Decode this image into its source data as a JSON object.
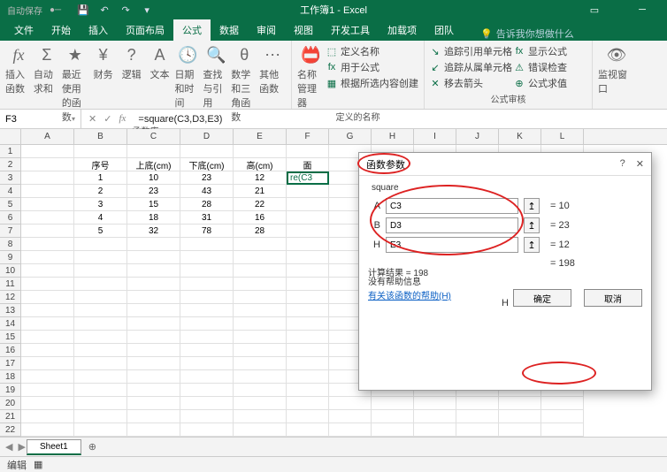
{
  "titlebar": {
    "autosave": "自动保存",
    "title": "工作簿1 - Excel"
  },
  "tabs": {
    "items": [
      "文件",
      "开始",
      "插入",
      "页面布局",
      "公式",
      "数据",
      "审阅",
      "视图",
      "开发工具",
      "加载项",
      "团队"
    ],
    "active": 4,
    "tell_placeholder": "告诉我你想做什么"
  },
  "ribbon": {
    "group1": {
      "btn1": "插入函数",
      "btn2": "自动求和",
      "btn3": "最近使用的函数",
      "btn4": "财务",
      "btn5": "逻辑",
      "btn6": "文本",
      "btn7": "日期和时间",
      "btn8": "查找与引用",
      "btn9": "数学和三角函数",
      "btn10": "其他函数",
      "label": "函数库"
    },
    "group2": {
      "btn": "名称管理器",
      "i1": "定义名称",
      "i2": "用于公式",
      "i3": "根据所选内容创建",
      "label": "定义的名称"
    },
    "group3": {
      "i1": "追踪引用单元格",
      "i2": "追踪从属单元格",
      "i3": "移去箭头",
      "i4": "显示公式",
      "i5": "错误检查",
      "i6": "公式求值",
      "label": "公式审核"
    },
    "group4": {
      "btn": "监视窗口"
    }
  },
  "namebox": {
    "ref": "F3",
    "formula": "=square(C3,D3,E3)"
  },
  "columns": [
    "A",
    "B",
    "C",
    "D",
    "E",
    "F",
    "G",
    "H",
    "I",
    "J",
    "K",
    "L"
  ],
  "headers": {
    "B": "序号",
    "C": "上底(cm)",
    "D": "下底(cm)",
    "E": "高(cm)",
    "F": "面"
  },
  "table": [
    {
      "n": "1",
      "c": "10",
      "d": "23",
      "e": "12"
    },
    {
      "n": "2",
      "c": "23",
      "d": "43",
      "e": "21"
    },
    {
      "n": "3",
      "c": "15",
      "d": "28",
      "e": "22"
    },
    {
      "n": "4",
      "c": "18",
      "d": "31",
      "e": "16"
    },
    {
      "n": "5",
      "c": "32",
      "d": "78",
      "e": "28"
    }
  ],
  "activecell": {
    "display": "re(C3"
  },
  "sheet": {
    "name": "Sheet1"
  },
  "status": {
    "mode": "编辑"
  },
  "dialog": {
    "title": "函数参数",
    "fn": "square",
    "params": [
      {
        "label": "A",
        "value": "C3",
        "result": "= 10"
      },
      {
        "label": "B",
        "value": "D3",
        "result": "= 23"
      },
      {
        "label": "H",
        "value": "E3",
        "result": "= 12"
      }
    ],
    "total": "= 198",
    "nohelp": "没有帮助信息",
    "centerH": "H",
    "resultlabel": "计算结果 = 198",
    "helplink": "有关该函数的帮助(H)",
    "ok": "确定",
    "cancel": "取消"
  },
  "chart_data": {
    "type": "table",
    "columns": [
      "序号",
      "上底(cm)",
      "下底(cm)",
      "高(cm)"
    ],
    "rows": [
      [
        1,
        10,
        23,
        12
      ],
      [
        2,
        23,
        43,
        21
      ],
      [
        3,
        15,
        28,
        22
      ],
      [
        4,
        18,
        31,
        16
      ],
      [
        5,
        32,
        78,
        28
      ]
    ]
  }
}
